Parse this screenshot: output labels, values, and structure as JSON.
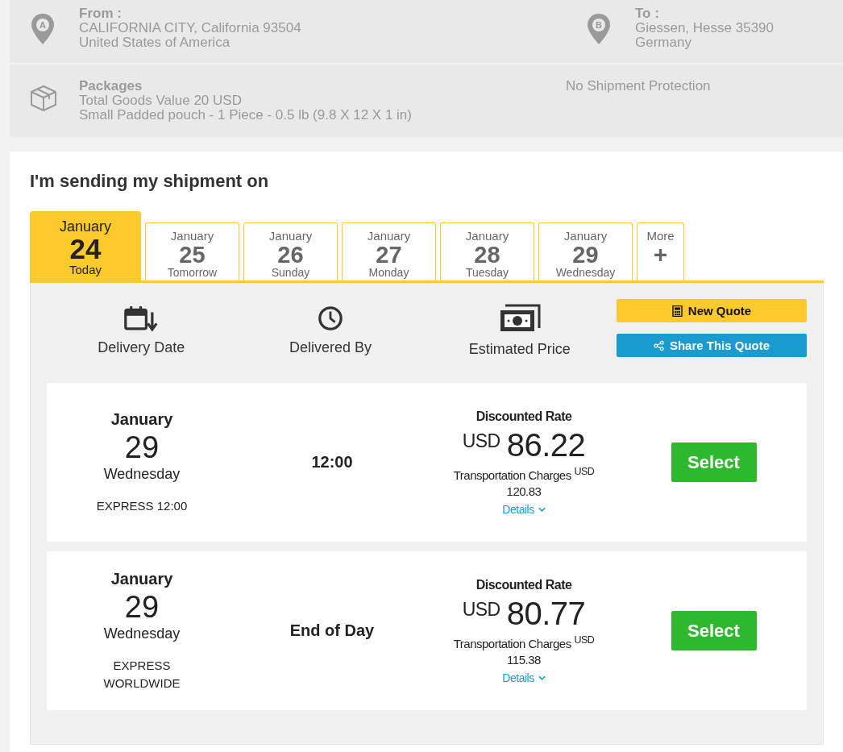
{
  "from": {
    "label": "From :",
    "lines": [
      "CALIFORNIA CITY, California 93504",
      "United States of America"
    ],
    "pin": "A"
  },
  "to": {
    "label": "To :",
    "lines": [
      "Giessen, Hesse 35390",
      "Germany"
    ],
    "pin": "B"
  },
  "packages": {
    "label": "Packages",
    "lines": [
      "Total Goods Value 20 USD",
      "Small Padded pouch - 1 Piece - 0.5 lb (9.8 X 12 X 1 in)"
    ]
  },
  "protection": "No Shipment Protection",
  "heading": "I'm sending my shipment on",
  "date_tabs": [
    {
      "month": "January",
      "day": "24",
      "weekday": "Today",
      "selected": true
    },
    {
      "month": "January",
      "day": "25",
      "weekday": "Tomorrow",
      "selected": false
    },
    {
      "month": "January",
      "day": "26",
      "weekday": "Sunday",
      "selected": false
    },
    {
      "month": "January",
      "day": "27",
      "weekday": "Monday",
      "selected": false
    },
    {
      "month": "January",
      "day": "28",
      "weekday": "Tuesday",
      "selected": false
    },
    {
      "month": "January",
      "day": "29",
      "weekday": "Wednesday",
      "selected": false
    }
  ],
  "more_tab": {
    "label": "More",
    "symbol": "+"
  },
  "columns": [
    "Delivery Date",
    "Delivered By",
    "Estimated Price"
  ],
  "new_quote": "New Quote",
  "share_quote": "Share This Quote",
  "quotes": [
    {
      "month": "January",
      "day": "29",
      "weekday": "Wednesday",
      "service": "EXPRESS 12:00",
      "delivered_by": "12:00",
      "rate_label": "Discounted Rate",
      "currency": "USD",
      "price": "86.22",
      "charges_label": "Transportation Charges $^{USD}$",
      "charges": "120.83",
      "details": "Details",
      "button": "Select"
    },
    {
      "month": "January",
      "day": "29",
      "weekday": "Wednesday",
      "service": "EXPRESS WORLDWIDE",
      "delivered_by": "End of Day",
      "rate_label": "Discounted Rate",
      "currency": "USD",
      "price": "80.77",
      "charges_label": "Transportation Charges $^{USD}$",
      "charges": "115.38",
      "details": "Details",
      "button": "Select"
    }
  ]
}
